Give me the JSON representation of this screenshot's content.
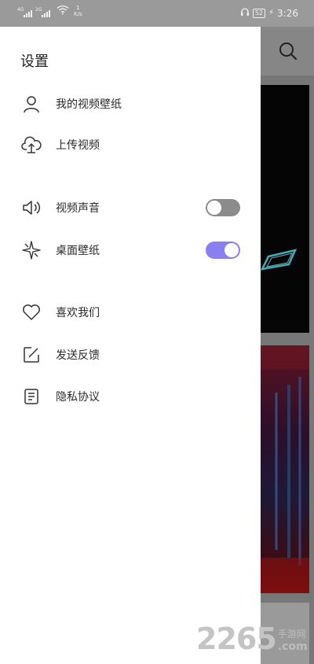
{
  "status_bar": {
    "sim1_tag": "4G",
    "sim2_tag": "2G",
    "speed_value": "1",
    "speed_unit": "K/s",
    "battery": "52",
    "time": "3:26"
  },
  "drawer": {
    "title": "设置",
    "items": [
      {
        "label": "我的视频壁纸",
        "icon": "user-icon"
      },
      {
        "label": "上传视频",
        "icon": "cloud-upload-icon"
      },
      {
        "label": "视频声音",
        "icon": "speaker-icon",
        "toggle": false
      },
      {
        "label": "桌面壁纸",
        "icon": "sparkle-icon",
        "toggle": true
      },
      {
        "label": "喜欢我们",
        "icon": "heart-icon"
      },
      {
        "label": "发送反馈",
        "icon": "edit-icon"
      },
      {
        "label": "隐私协议",
        "icon": "document-icon"
      }
    ]
  },
  "colors": {
    "toggle_on": "#8a7ff0",
    "toggle_off": "#8c8c8c"
  },
  "watermark": {
    "number": "2265",
    "cn": "手游网",
    "com": ".com"
  }
}
